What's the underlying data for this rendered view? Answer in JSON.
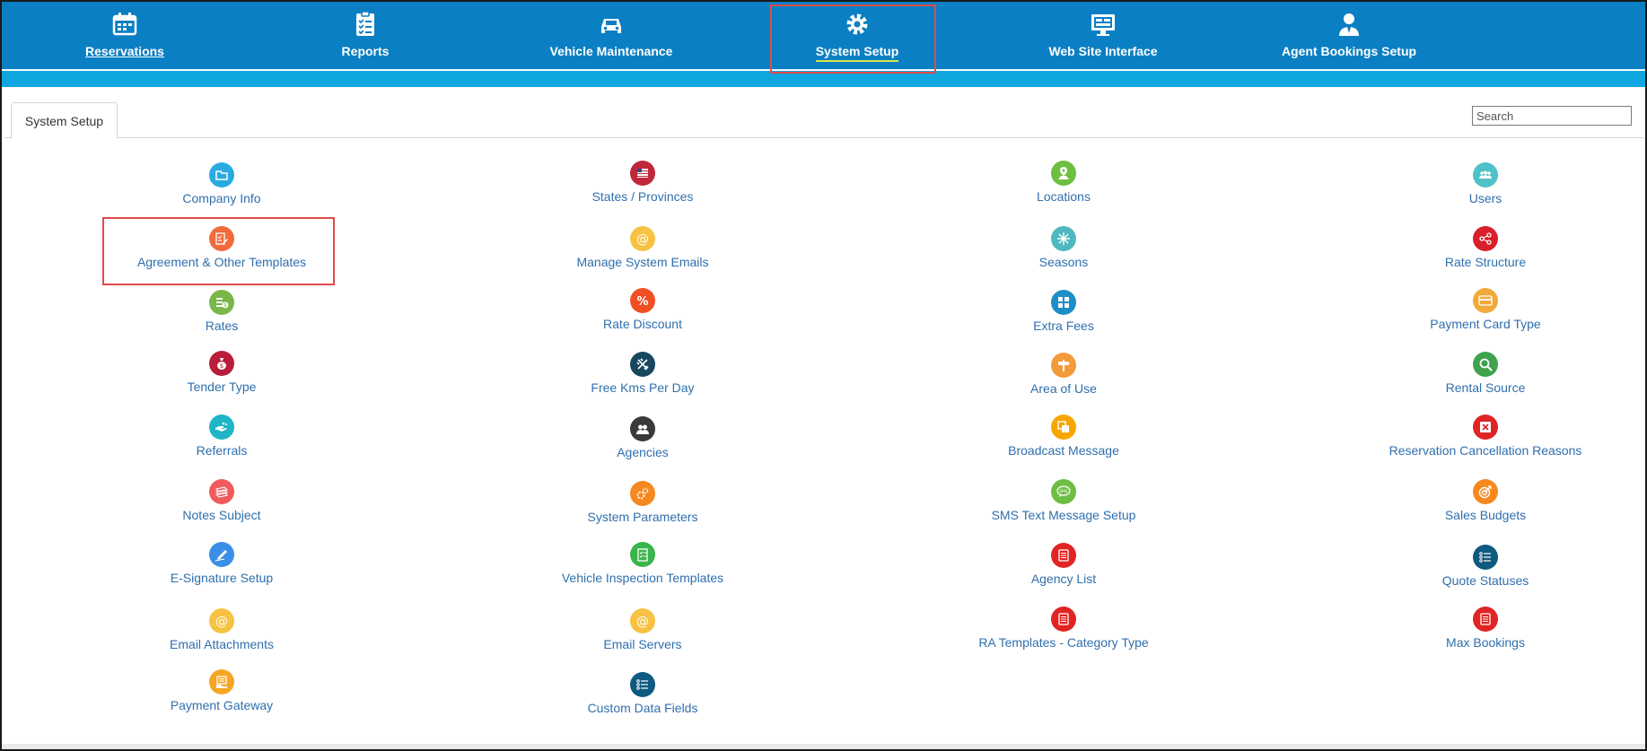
{
  "nav": {
    "items": [
      {
        "label": "Reservations",
        "icon": "calendar-icon"
      },
      {
        "label": "Reports",
        "icon": "checklist-icon"
      },
      {
        "label": "Vehicle Maintenance",
        "icon": "car-icon"
      },
      {
        "label": "System Setup",
        "icon": "gear-icon"
      },
      {
        "label": "Web Site Interface",
        "icon": "monitor-icon"
      },
      {
        "label": "Agent Bookings Setup",
        "icon": "agent-icon"
      }
    ],
    "active": "System Setup",
    "colors": {
      "bar": "#0a7fc3",
      "strip": "#10a6df",
      "active_underline": "#d8e64a"
    }
  },
  "tab": {
    "label": "System Setup"
  },
  "search": {
    "placeholder": "Search"
  },
  "columns": [
    [
      {
        "label": "Company Info",
        "icon": "folder-icon",
        "color": "#29abe2"
      },
      {
        "label": "Agreement & Other Templates",
        "icon": "document-edit-icon",
        "color": "#f06a3c"
      },
      {
        "label": "Rates",
        "icon": "dollar-icon",
        "color": "#7ab648"
      },
      {
        "label": "Tender Type",
        "icon": "money-bag-icon",
        "color": "#b81d3a"
      },
      {
        "label": "Referrals",
        "icon": "hand-icon",
        "color": "#1fb5c6"
      },
      {
        "label": "Notes Subject",
        "icon": "notes-icon",
        "color": "#ef5b5b"
      },
      {
        "label": "E-Signature Setup",
        "icon": "pen-icon",
        "color": "#3a8ee6"
      },
      {
        "label": "Email Attachments",
        "icon": "at-icon",
        "color": "#f7c243"
      },
      {
        "label": "Payment Gateway",
        "icon": "payment-icon",
        "color": "#f5a623"
      }
    ],
    [
      {
        "label": "States / Provinces",
        "icon": "flag-icon",
        "color": "#c0273a"
      },
      {
        "label": "Manage System Emails",
        "icon": "at-icon",
        "color": "#f7c243"
      },
      {
        "label": "Rate Discount",
        "icon": "percent-icon",
        "color": "#f04e23"
      },
      {
        "label": "Free Kms Per Day",
        "icon": "route-icon",
        "color": "#17485f"
      },
      {
        "label": "Agencies",
        "icon": "people-icon",
        "color": "#3a3a3a"
      },
      {
        "label": "System Parameters",
        "icon": "gears-icon",
        "color": "#f5881f"
      },
      {
        "label": "Vehicle Inspection Templates",
        "icon": "checklist-icon",
        "color": "#39b54a"
      },
      {
        "label": "Email Servers",
        "icon": "at-icon",
        "color": "#f7c243"
      },
      {
        "label": "Custom Data Fields",
        "icon": "list-icon",
        "color": "#0f5a80"
      }
    ],
    [
      {
        "label": "Locations",
        "icon": "map-pin-icon",
        "color": "#6cbf3f"
      },
      {
        "label": "Seasons",
        "icon": "snowflake-icon",
        "color": "#4fb8c0"
      },
      {
        "label": "Extra Fees",
        "icon": "grid-icon",
        "color": "#1e8fc6"
      },
      {
        "label": "Area of Use",
        "icon": "signpost-icon",
        "color": "#f39a3c"
      },
      {
        "label": "Broadcast Message",
        "icon": "copy-icon",
        "color": "#f7a600"
      },
      {
        "label": "SMS Text Message Setup",
        "icon": "sms-icon",
        "color": "#6ebe44"
      },
      {
        "label": "Agency List",
        "icon": "document-icon",
        "color": "#e02424"
      },
      {
        "label": "RA Templates - Category Type",
        "icon": "document-icon",
        "color": "#e02424"
      }
    ],
    [
      {
        "label": "Users",
        "icon": "users-icon",
        "color": "#4fc1c9"
      },
      {
        "label": "Rate Structure",
        "icon": "share-icon",
        "color": "#d81f2a"
      },
      {
        "label": "Payment Card Type",
        "icon": "card-icon",
        "color": "#f2a93b"
      },
      {
        "label": "Rental Source",
        "icon": "magnifier-icon",
        "color": "#3fa34d"
      },
      {
        "label": "Reservation Cancellation Reasons",
        "icon": "cancel-icon",
        "color": "#e02424"
      },
      {
        "label": "Sales Budgets",
        "icon": "target-icon",
        "color": "#f5881f"
      },
      {
        "label": "Quote Statuses",
        "icon": "list-icon",
        "color": "#0f5a80"
      },
      {
        "label": "Max Bookings",
        "icon": "document-icon",
        "color": "#e02424"
      }
    ]
  ]
}
